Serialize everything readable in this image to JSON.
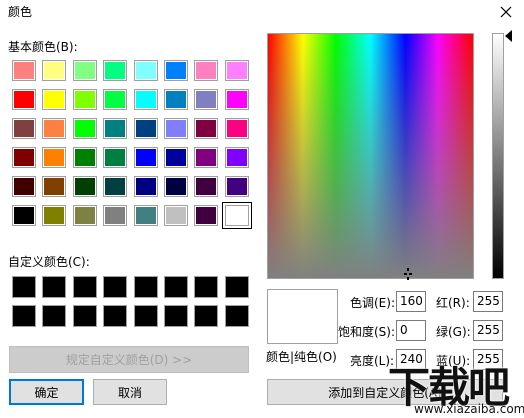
{
  "window": {
    "title": "颜色"
  },
  "basic_colors": {
    "label": "基本颜色(B):",
    "rows": [
      [
        "#ff8080",
        "#ffff80",
        "#80ff80",
        "#00ff80",
        "#80ffff",
        "#0080ff",
        "#ff80c0",
        "#ff80ff"
      ],
      [
        "#ff0000",
        "#ffff00",
        "#80ff00",
        "#00ff40",
        "#00ffff",
        "#0080c0",
        "#8080c0",
        "#ff00ff"
      ],
      [
        "#804040",
        "#ff8040",
        "#00ff00",
        "#008080",
        "#004080",
        "#8080ff",
        "#800040",
        "#ff0080"
      ],
      [
        "#800000",
        "#ff8000",
        "#008000",
        "#008040",
        "#0000ff",
        "#0000a0",
        "#800080",
        "#8000ff"
      ],
      [
        "#400000",
        "#804000",
        "#004000",
        "#004040",
        "#000080",
        "#000040",
        "#400040",
        "#400080"
      ],
      [
        "#000000",
        "#808000",
        "#808040",
        "#808080",
        "#408080",
        "#c0c0c0",
        "#400040",
        "#ffffff"
      ]
    ]
  },
  "custom_colors": {
    "label": "自定义颜色(C):",
    "rows": [
      [
        "#000000",
        "#000000",
        "#000000",
        "#000000",
        "#000000",
        "#000000",
        "#000000",
        "#000000"
      ],
      [
        "#000000",
        "#000000",
        "#000000",
        "#000000",
        "#000000",
        "#000000",
        "#000000",
        "#000000"
      ]
    ]
  },
  "buttons": {
    "define_custom": "规定自定义颜色(D) >>",
    "ok": "确定",
    "cancel": "取消",
    "add_custom": "添加到自定义颜色(A)"
  },
  "preview": {
    "label": "颜色|纯色(O)",
    "color": "#ffffff"
  },
  "fields": {
    "hue": {
      "label": "色调(E):",
      "value": "160"
    },
    "sat": {
      "label": "饱和度(S):",
      "value": "0"
    },
    "lum": {
      "label": "亮度(L):",
      "value": "240"
    },
    "red": {
      "label": "红(R):",
      "value": "255"
    },
    "green": {
      "label": "绿(G):",
      "value": "255"
    },
    "blue": {
      "label": "蓝(U):",
      "value": "255"
    }
  },
  "watermark": {
    "text": "下载吧",
    "url": "www.xiazaiba.com"
  }
}
